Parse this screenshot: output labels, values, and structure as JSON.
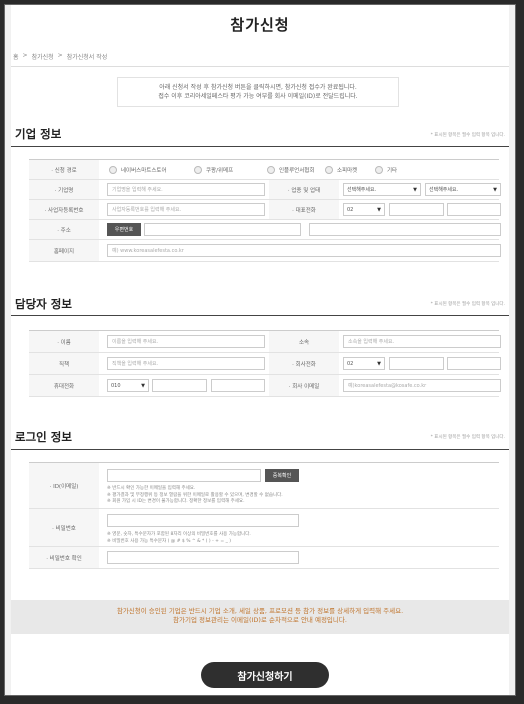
{
  "header": {
    "title": "참가신청",
    "breadcrumb": [
      "홈",
      "참가신청",
      "참가신청서 작성"
    ]
  },
  "notice": {
    "line1": "아래 신청서 작성 후 참가신청 버튼을 클릭하시면, 참가신청 접수가 완료됩니다.",
    "line2": "접수 이후 코리아세일페스타 평가 가능 여부를 회사 이메일(ID)로 전달드립니다."
  },
  "required_note": "* 표시된 항목은 필수 입력 항목 입니다.",
  "company": {
    "section_title": "기업 정보",
    "channel_label": "· 신청 경로",
    "channels": [
      "네이버스마트스토어",
      "쿠팡/위메프",
      "인플루언서협회",
      "소피마켓",
      "기타"
    ],
    "company_name_label": "· 기업명",
    "company_name_placeholder": "기업명을 입력해 주세요.",
    "industry_label": "· 업종 및 업태",
    "industry_select1": "선택해주세요.",
    "industry_select2": "선택해주세요.",
    "biznum_label": "· 사업자등록번호",
    "biznum_placeholder": "사업자등록번호를 입력해 주세요.",
    "phone_label": "· 대표전화",
    "phone_prefix": "02",
    "address_label": "· 주소",
    "zipcode_button": "우편번호",
    "homepage_label": "홈페이지",
    "homepage_placeholder": "예) www.koreasalefesta.co.kr"
  },
  "manager": {
    "section_title": "담당자 정보",
    "name_label": "· 이름",
    "name_placeholder": "이름을 입력해 주세요.",
    "dept_label": "소속",
    "dept_placeholder": "소속을 입력해 주세요.",
    "position_label": "직책",
    "position_placeholder": "직책을 입력해 주세요.",
    "office_phone_label": "· 회사전화",
    "office_phone_prefix": "02",
    "mobile_label": "휴대전화",
    "mobile_prefix": "010",
    "email_label": "· 회사 이메일",
    "email_placeholder": "예)koreasalefesta@kosafe.co.kr"
  },
  "login": {
    "section_title": "로그인 정보",
    "id_label": "· ID(이메일)",
    "dup_button": "중복확인",
    "id_hint1": "※ 반드시 확인 가능한 이메일을 입력해 주세요.",
    "id_hint2": "※ 평가결과 및 부정행위 등 정보 열람을 위한 이메일로 활용할 수 있으며, 변경할 수 없습니다.",
    "id_hint3": "※ 회원 가입 시 ID는 변경이 불가능합니다. 정확한 정보를 입력해 주세요.",
    "pw_label": "· 비밀번호",
    "pw_hint1": "※ 영문, 숫자, 특수문자가 포함된 8자리 이상의 비밀번호를 사용 가능합니다.",
    "pw_hint2": "※ 비밀번호 사용 가능 특수문자 ( @ # $ % ^ & * ( ) - + = _ )",
    "pw_confirm_label": "· 비밀번호 확인"
  },
  "footer": {
    "line1": "참가신청이 승인된 기업은 반드시 기업 소개, 세일 상품, 프로모션 등 참가 정보를 상세하게 입력해 주세요.",
    "line2": "참가기업 정보관리는 이메일(ID)로 순차적으로 안내 예정입니다.",
    "submit_label": "참가신청하기"
  }
}
